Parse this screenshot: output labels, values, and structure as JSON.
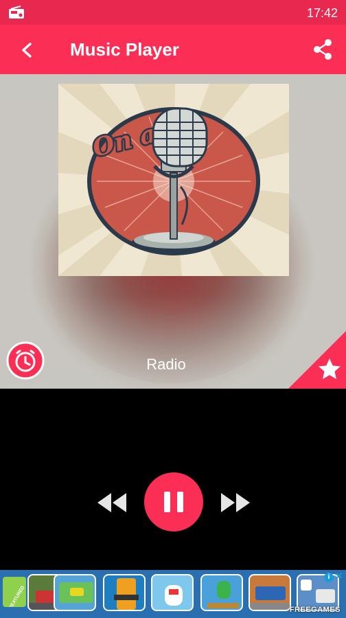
{
  "status_bar": {
    "time": "17:42",
    "app_icon": "radio-icon"
  },
  "app_bar": {
    "title": "Music Player",
    "back_icon": "back-arrow-icon",
    "share_icon": "share-icon"
  },
  "artwork": {
    "lettering": "On air!",
    "image": "vintage-microphone-illustration"
  },
  "player": {
    "station_name": "Radio",
    "alarm_icon": "alarm-clock-icon",
    "favorite_icon": "star-icon",
    "state": "playing"
  },
  "controls": {
    "rewind_icon": "rewind-icon",
    "pause_icon": "pause-icon",
    "forward_icon": "fast-forward-icon"
  },
  "ad": {
    "brand": "FREEGAMES",
    "info_icon": "i",
    "close_icon": "✕",
    "badge": "FEATURED",
    "tile_count": 7
  },
  "colors": {
    "accent": "#fb2f55",
    "status_bar": "#e8284f",
    "background": "#000000",
    "ad_background": "#2a6fb0"
  }
}
